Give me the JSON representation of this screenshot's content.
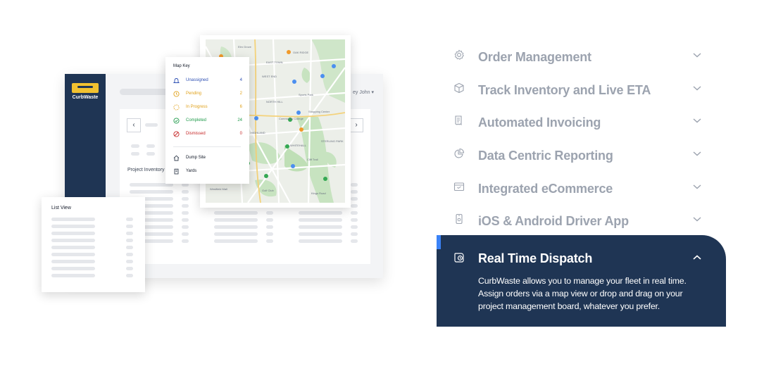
{
  "illustration": {
    "brand": "CurbWaste",
    "user_label": "ey John ▾",
    "prev_arrow": "‹",
    "next_arrow": "›",
    "project_label": "Project Inventory",
    "list_view_title": "List View",
    "map_key": {
      "title": "Map Key",
      "statuses": [
        {
          "label": "Unassigned",
          "count": "4",
          "color": "#2d4fb3",
          "icon": "bell-icon"
        },
        {
          "label": "Pending",
          "count": "2",
          "color": "#e0a11a",
          "icon": "clock-icon"
        },
        {
          "label": "In Progress",
          "count": "6",
          "color": "#e0a11a",
          "icon": "progress-icon"
        },
        {
          "label": "Completed",
          "count": "24",
          "color": "#1f9a4a",
          "icon": "check-circle-icon"
        },
        {
          "label": "Dismissed",
          "count": "0",
          "color": "#c62828",
          "icon": "ban-icon"
        }
      ],
      "locations": [
        {
          "label": "Dump Site",
          "icon": "home-icon"
        },
        {
          "label": "Yards",
          "icon": "building-icon"
        }
      ]
    },
    "map_labels": [
      "OAK RIDGE",
      "EAST TOWN",
      "WEST END",
      "RIVER PARK",
      "NORTH HILL",
      "Shopping Center",
      "WHITEHALL",
      "Golf Club",
      "Community College",
      "Sports Park",
      "HIGHLAND",
      "LAKESIDE",
      "STERLING PARK",
      "Cliff Trail",
      "BAYVIEW",
      "Westfield Mall",
      "Elm Grove",
      "Kings Road"
    ]
  },
  "accordion": {
    "items": [
      {
        "label": "Order Management",
        "icon": "gear-icon",
        "expanded": false
      },
      {
        "label": "Track Inventory and Live ETA",
        "icon": "box-icon",
        "expanded": false
      },
      {
        "label": "Automated Invoicing",
        "icon": "invoice-icon",
        "expanded": false
      },
      {
        "label": "Data Centric Reporting",
        "icon": "pie-chart-icon",
        "expanded": false
      },
      {
        "label": "Integrated eCommerce",
        "icon": "storefront-icon",
        "expanded": false
      },
      {
        "label": "iOS & Android Driver App",
        "icon": "mobile-icon",
        "expanded": false
      }
    ],
    "active": {
      "label": "Real Time Dispatch",
      "icon": "dispatch-clock-icon",
      "expanded": true,
      "description": "CurbWaste allows you to manage your fleet in real time. Assign orders via a map view or drop and drag on your project management board, whatever you prefer."
    }
  },
  "colors": {
    "navy": "#1f3554",
    "brand_yellow": "#f2c230",
    "muted_text": "#9ca3af",
    "accent_blue": "#3b82f6"
  }
}
